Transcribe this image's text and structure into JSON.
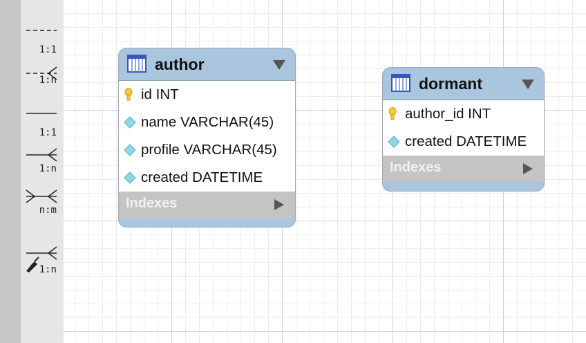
{
  "palette": {
    "tools": [
      {
        "name": "one-to-one-non-identifying",
        "label": "1:1"
      },
      {
        "name": "one-to-many-non-identifying",
        "label": "1:n"
      },
      {
        "name": "one-to-one-identifying",
        "label": "1:1"
      },
      {
        "name": "one-to-many-identifying",
        "label": "1:n"
      },
      {
        "name": "many-to-many",
        "label": "n:m"
      },
      {
        "name": "one-to-many-existing-columns",
        "label": "1:n"
      }
    ]
  },
  "tables": [
    {
      "name": "author",
      "columns": [
        {
          "text": "id INT",
          "kind": "key-icon"
        },
        {
          "text": "name VARCHAR(45)",
          "kind": "column-diamond-icon"
        },
        {
          "text": "profile VARCHAR(45)",
          "kind": "column-diamond-icon"
        },
        {
          "text": "created DATETIME",
          "kind": "column-diamond-icon"
        }
      ],
      "indexes_label": "Indexes"
    },
    {
      "name": "dormant",
      "columns": [
        {
          "text": "author_id INT",
          "kind": "key-icon"
        },
        {
          "text": "created DATETIME",
          "kind": "column-diamond-icon"
        }
      ],
      "indexes_label": "Indexes"
    }
  ],
  "colors": {
    "header": "#a9c6de",
    "indexes": "#c4c4c4",
    "key": "#f3cc3b",
    "diamond": "#8fd6e6"
  }
}
